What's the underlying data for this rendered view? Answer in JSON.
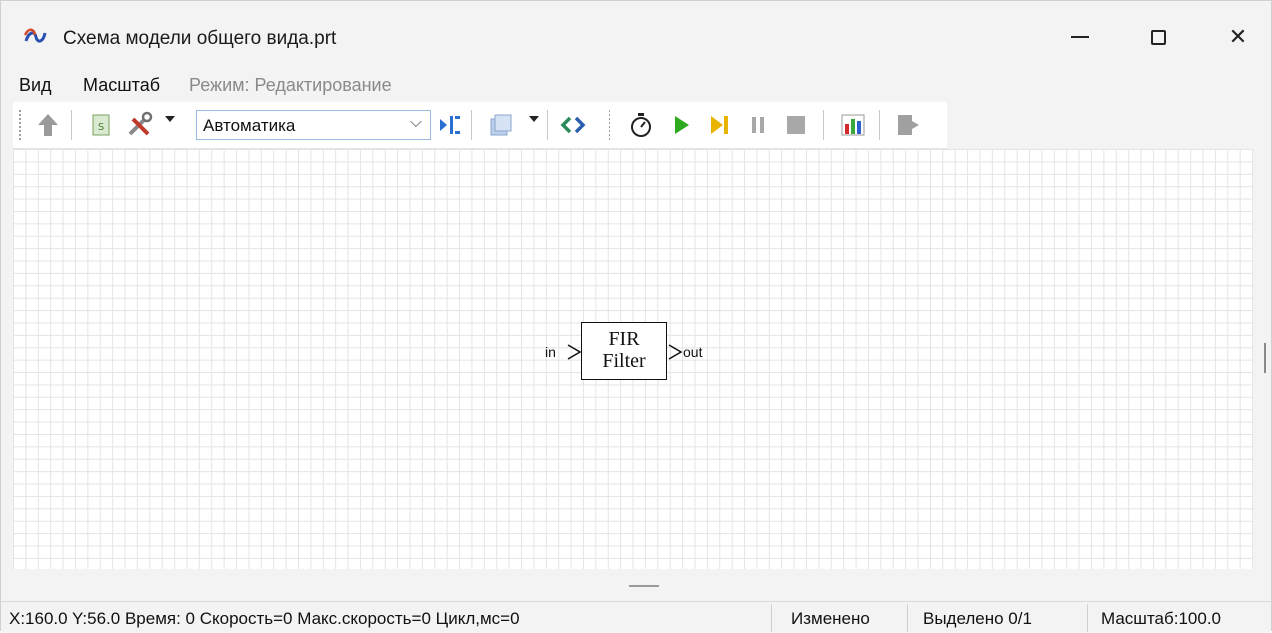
{
  "window": {
    "title": "Схема модели общего вида.prt",
    "minimize_icon": "minimize-icon",
    "maximize_icon": "maximize-icon",
    "close_glyph": "✕"
  },
  "menu": {
    "items": [
      "Вид",
      "Масштаб"
    ],
    "mode_label": "Режим: Редактирование"
  },
  "toolbar": {
    "mode_dropdown_value": "Автоматика",
    "icons": [
      "up-arrow-icon",
      "script-icon",
      "tools-icon",
      "dropdown-arrow-icon",
      "compile-icon",
      "layers-icon",
      "dropdown-arrow-icon",
      "link-icon",
      "stopwatch-icon",
      "play-icon",
      "step-icon",
      "pause-icon",
      "stop-icon",
      "chart-icon",
      "exit-icon"
    ],
    "colors": {
      "play": "#2eaa1f",
      "step": "#e8b400",
      "chart_red": "#d32a2a",
      "chart_green": "#3aa83a",
      "chart_blue": "#2e5fcf",
      "link": "#2a8a5a",
      "compile": "#2a6fd4"
    }
  },
  "canvas": {
    "block": {
      "line1": "FIR",
      "line2": "Filter",
      "input_port": "in",
      "output_port": "out"
    }
  },
  "status": {
    "coords": "X:160.0  Y:56.0 Время: 0 Скорость=0 Макс.скорость=0 Цикл,мс=0",
    "modified": "Изменено",
    "selected": "Выделено 0/1",
    "zoom": "Масштаб:100.0"
  }
}
